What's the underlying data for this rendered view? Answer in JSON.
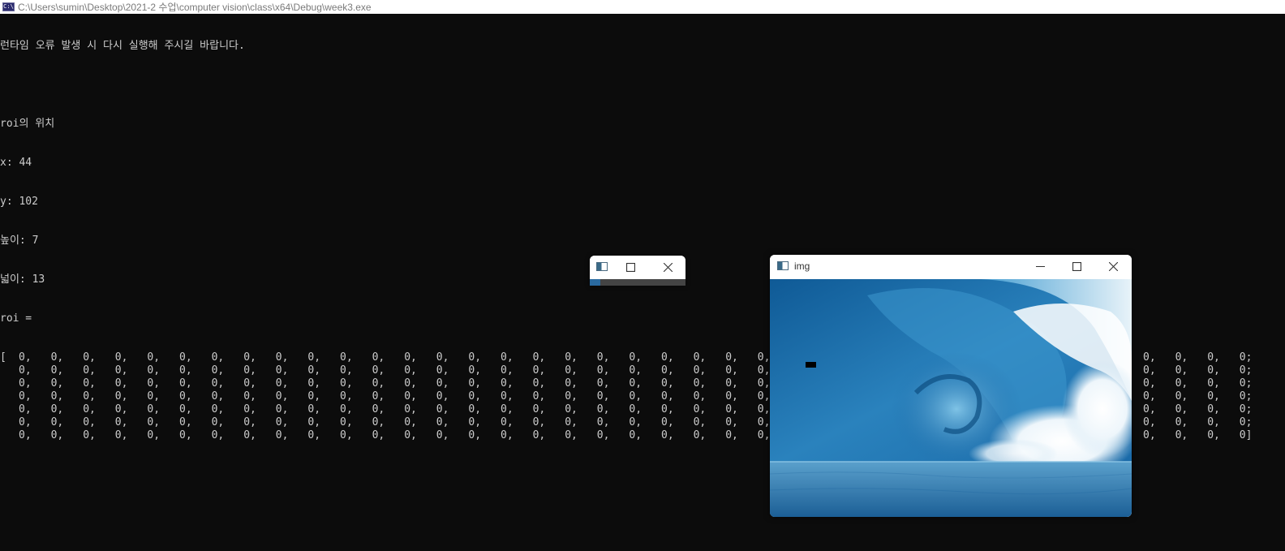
{
  "console": {
    "title": "C:\\Users\\sumin\\Desktop\\2021-2 수업\\computer vision\\class\\x64\\Debug\\week3.exe",
    "icon": "console-app-icon",
    "lines": [
      "런타임 오류 발생 시 다시 실행해 주시길 바랍니다.",
      "",
      "roi의 위치",
      "x: 44",
      "y: 102",
      "높이: 7",
      "넓이: 13",
      "roi ="
    ],
    "matrix": {
      "open_bracket": "[",
      "close_bracket": "]",
      "rows": 7,
      "cols": 39,
      "value": "0",
      "col_separator": ",",
      "row_separator": ";"
    }
  },
  "roi_window": {
    "title": "",
    "icon": "window-app-icon",
    "minimize_glyph": "─",
    "maximize_glyph": "□",
    "close_glyph": "✕"
  },
  "img_window": {
    "title": "img",
    "icon": "window-app-icon",
    "minimize_glyph": "─",
    "maximize_glyph": "□",
    "close_glyph": "✕",
    "image": "ocean-wave-photo",
    "roi_marker_color": "#000000"
  },
  "colors": {
    "console_bg": "#0c0c0c",
    "console_text": "#cccccc",
    "titlebar_bg": "#ffffff",
    "titlebar_text": "#7a7a7a"
  }
}
